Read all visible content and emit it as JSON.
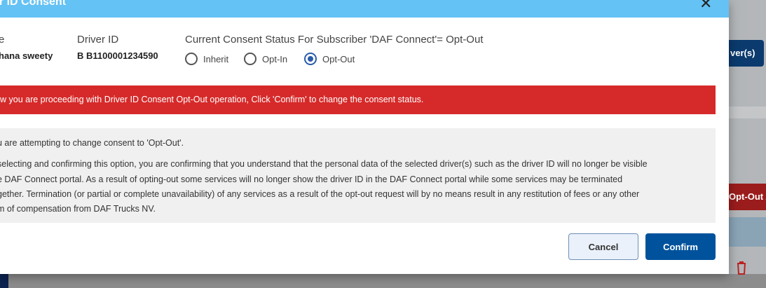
{
  "background": {
    "import_button_label": "ver(s)",
    "optout_button_label": "Opt-Out A"
  },
  "modal": {
    "title": "er ID Consent",
    "name_label": "e",
    "name_value": "hana sweety",
    "driver_id_label": "Driver ID",
    "driver_id_value": "B B1100001234590",
    "consent_label": "Current Consent Status For Subscriber 'DAF Connect'= Opt-Out",
    "options": [
      {
        "label": "Inherit",
        "selected": false
      },
      {
        "label": "Opt-In",
        "selected": false
      },
      {
        "label": "Opt-Out",
        "selected": true
      }
    ],
    "alert": "w you are proceeding with Driver ID Consent Opt-Out operation, Click 'Confirm' to change the consent status.",
    "info_lines": [
      "u are attempting to change consent to 'Opt-Out'.",
      "selecting and confirming this option, you are confirming that you understand that the personal data of the selected driver(s) such as the driver ID will no longer be visible",
      "e DAF Connect portal. As a result of opting-out some services will no longer show the driver ID in the DAF Connect portal while some services may be terminated",
      "gether. Termination (or partial or complete unavailability) of any services as a result of the opt-out request will by no means result in any restitution of fees or any other",
      "m of compensation from DAF Trucks NV."
    ],
    "cancel_label": "Cancel",
    "confirm_label": "Confirm"
  },
  "colors": {
    "header": "#64c2f5",
    "alert": "#d62a2a",
    "confirm": "#00529c"
  }
}
